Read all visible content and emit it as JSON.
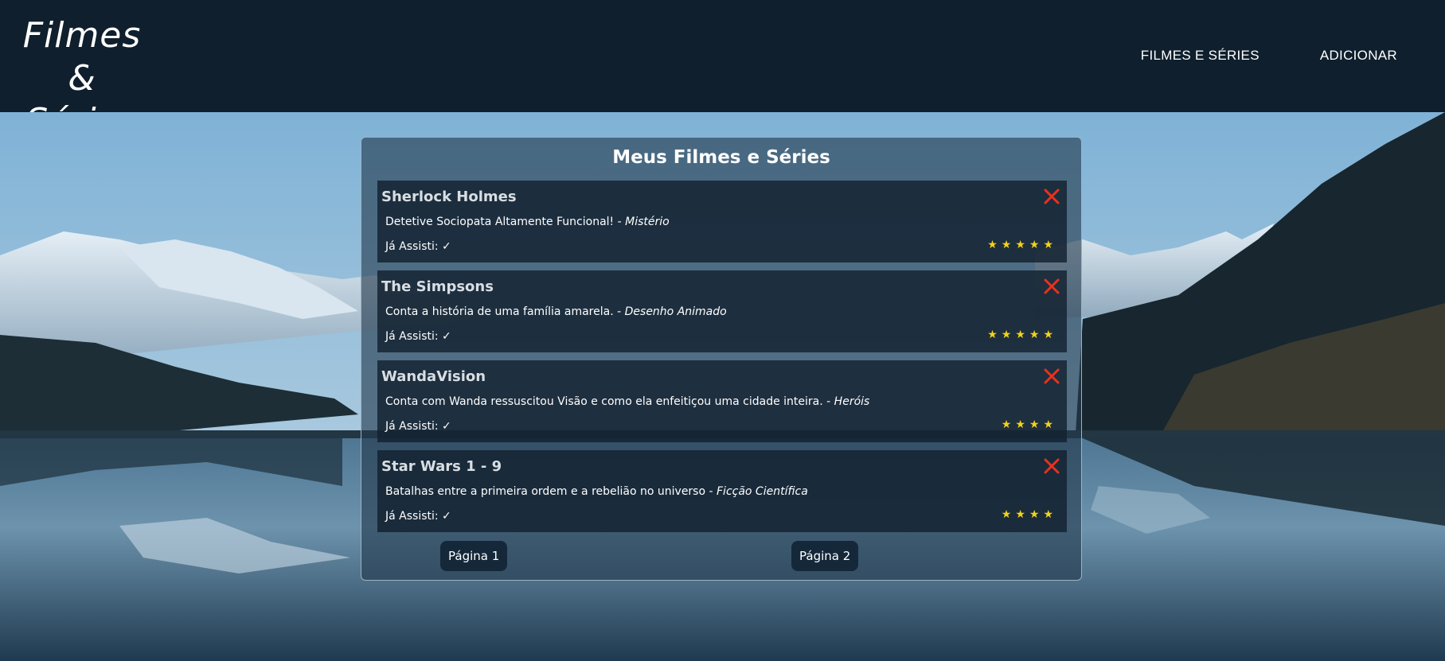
{
  "header": {
    "logo_line1": "Filmes &",
    "logo_line2": "Séries",
    "nav": [
      "FILMES E SÉRIES",
      "ADICIONAR"
    ]
  },
  "panel": {
    "title": "Meus Filmes e Séries",
    "items": [
      {
        "title": "Sherlock Holmes",
        "description": "Detetive Sociopata Altamente Funcional! - ",
        "genre": "Mistério",
        "watched": "Já Assisti: ✓",
        "stars": "★★★★★"
      },
      {
        "title": "The Simpsons",
        "description": "Conta a história de uma família amarela. - ",
        "genre": "Desenho Animado",
        "watched": "Já Assisti: ✓",
        "stars": "★★★★★"
      },
      {
        "title": "WandaVision",
        "description": "Conta com Wanda ressuscitou Visão e como ela enfeitiçou uma cidade inteira. - ",
        "genre": "Heróis",
        "watched": "Já Assisti: ✓",
        "stars": "★★★★"
      },
      {
        "title": "Star Wars 1 - 9",
        "description": "Batalhas entre a primeira ordem e a rebelião no universo - ",
        "genre": "Ficção Científica",
        "watched": "Já Assisti: ✓",
        "stars": "★★★★"
      }
    ],
    "pages": [
      "Página 1",
      "Página 2"
    ]
  },
  "colors": {
    "header_bg": "#0f1f2d",
    "star": "#f2d21b",
    "close": "#e8321e"
  }
}
